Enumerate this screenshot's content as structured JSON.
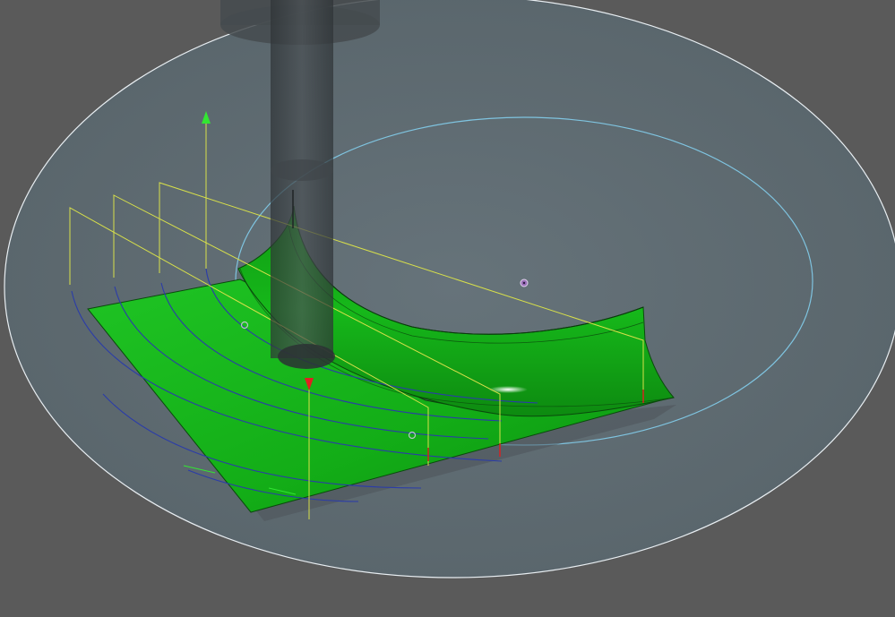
{
  "viewport": {
    "background_color": "#5a5a5a",
    "outer_disc_fill": "#5e686e",
    "outer_disc_stroke": "#e8eef2",
    "inner_circle_stroke": "#7fc4e0",
    "surface_color": "#17b51b",
    "surface_dark_color": "#0e8f12",
    "tool_color": "#3a3f42",
    "guide_line_color": "#d8e04a",
    "curve_color": "#2b3ca8",
    "marker_color": "#e02020",
    "axis_arrow_color": "#32e632",
    "icons": [
      "tool-holder-icon",
      "up-arrow-icon",
      "down-arrow-icon",
      "pivot-point-icon"
    ]
  }
}
